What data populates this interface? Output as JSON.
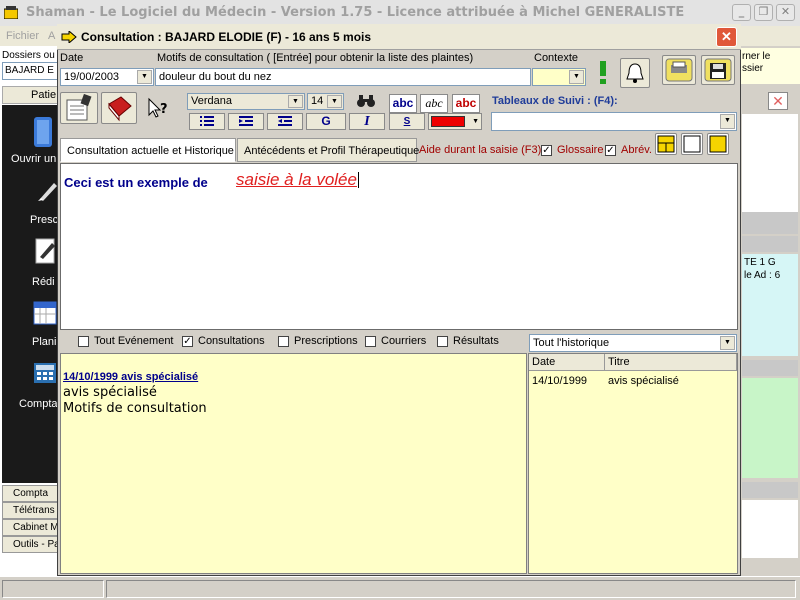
{
  "main_window": {
    "title": "Shaman - Le Logiciel du Médecin - Version 1.75 - Licence attribuée à Michel GENERALISTE",
    "menu": [
      "Fichier",
      "A"
    ],
    "dossiers_label": "Dossiers ou",
    "dossiers_value": "BAJARD E",
    "patient_tab": "Patie",
    "nav": [
      "Ouvrir un",
      "Presc",
      "Rédi",
      "Plani",
      "Compta"
    ],
    "bottom_tabs": [
      "Compta",
      "Télétrans",
      "Cabinet M",
      "Outils - Par"
    ],
    "right_note": "rner le\nssier",
    "right_info": "TE 1 G\nle Ad : 6"
  },
  "dialog": {
    "title": "Consultation : BAJARD ELODIE (F) -  16 ans 5 mois",
    "date_label": "Date",
    "date_value": "19/00/2003",
    "motifs_label": "Motifs de consultation ( [Entrée]  pour obtenir la liste des plaintes)",
    "motifs_value": "douleur du bout du nez",
    "contexte_label": "Contexte",
    "contexte_value": "",
    "font_name": "Verdana",
    "font_size": "14",
    "abc_labels": [
      "abc",
      "abc",
      "abc"
    ],
    "bold_label": "G",
    "italic_label": "I",
    "underline_label": "S",
    "text_color": "#ee0000",
    "tableaux_label": "Tableaux de Suivi : (F4):",
    "tableaux_value": "",
    "tabs": [
      "Consultation actuelle et Historique",
      "Antécédents et Profil Thérapeutique"
    ],
    "aide_label": "Aide durant la saisie (F3):",
    "glossaire_label": "Glossaire",
    "glossaire_checked": true,
    "abrev_label": "Abrév.",
    "abrev_checked": true,
    "editor_text_plain": "Ceci est un exemple de",
    "editor_text_styled": "saisie à la volée",
    "filters": [
      {
        "label": "Tout Evénement",
        "checked": false
      },
      {
        "label": "Consultations",
        "checked": true
      },
      {
        "label": "Prescriptions",
        "checked": false
      },
      {
        "label": "Courriers",
        "checked": false
      },
      {
        "label": "Résultats",
        "checked": false
      }
    ],
    "history_filter": "Tout l'historique",
    "history_entry": {
      "date_title": "14/10/1999 avis spécialisé",
      "line1": "avis spécialisé",
      "line2": "Motifs de consultation"
    },
    "list_columns": [
      "Date",
      "Titre"
    ],
    "list_rows": [
      {
        "date": "14/10/1999",
        "title": "avis spécialisé"
      }
    ]
  }
}
